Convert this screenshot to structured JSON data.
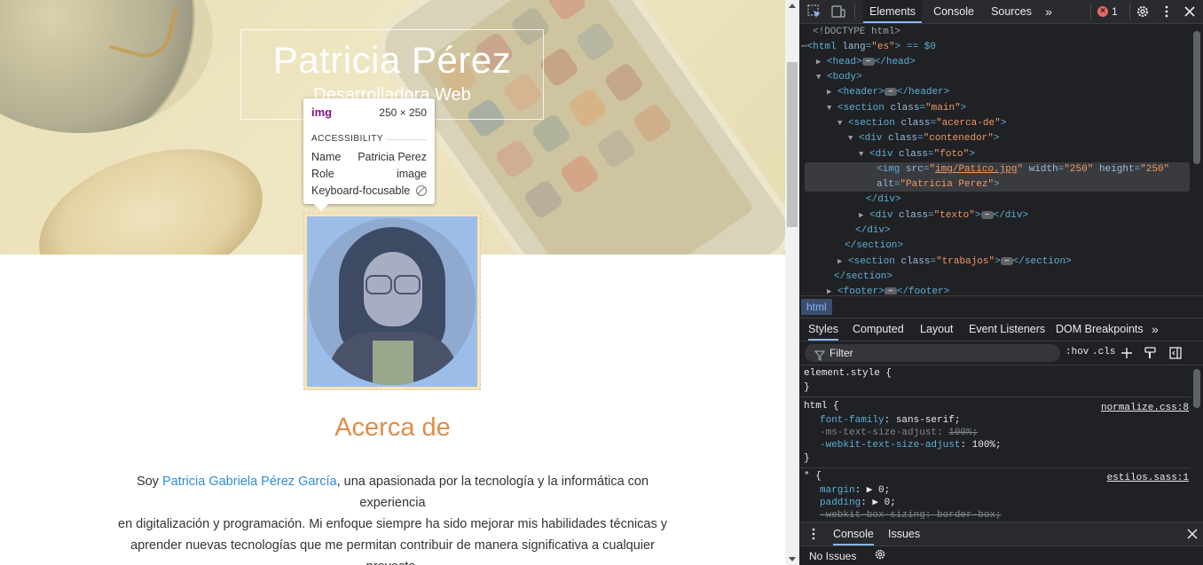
{
  "page": {
    "hero_name": "Patricia Pérez",
    "hero_role": "Desarrolladora Web",
    "about_title": "Acerca de",
    "about_prefix": "Soy ",
    "about_link": "Patricia Gabriela Pérez García",
    "about_line1_rest": ", una apasionada por la tecnología y la informática con experiencia",
    "about_line2": "en digitalización y programación. Mi enfoque siempre ha sido mejorar mis habilidades técnicas y",
    "about_line3": "aprender nuevas tecnologías que me permitan contribuir de manera significativa a cualquier proyecto.",
    "photo_alt": "Patricia Perez"
  },
  "tooltip": {
    "tag": "img",
    "size": "250 × 250",
    "section": "ACCESSIBILITY",
    "rows": [
      {
        "label": "Name",
        "value": "Patricia Perez"
      },
      {
        "label": "Role",
        "value": "image"
      },
      {
        "label": "Keyboard-focusable",
        "value": ""
      }
    ]
  },
  "devtools": {
    "tabs": [
      "Elements",
      "Console",
      "Sources"
    ],
    "active_tab": "Elements",
    "error_count": "1",
    "error_badge": "×",
    "icons": {
      "inspect": "inspect-icon",
      "device": "device-toggle-icon",
      "more_tabs": "chevrons-right-icon",
      "settings": "gear-icon",
      "menu": "kebab-menu-icon",
      "close": "close-icon"
    },
    "dom": {
      "doctype": "<!DOCTYPE html>",
      "html_open": "<html ",
      "html_lang_attr": "lang",
      "html_lang_val": "\"es\"",
      "html_suffix": "> == $0",
      "head": "<head>",
      "head_close": "</head>",
      "body": "<body>",
      "header": "<header>",
      "header_close": "</header>",
      "section_main_tag": "<section ",
      "section_main_attr": "class",
      "section_main_val": "\"main\"",
      "section_acerca_val": "\"acerca-de\"",
      "div_contenedor_val": "\"contenedor\"",
      "div_foto_val": "\"foto\"",
      "img_src_attr": "src",
      "img_src_val": "img/Patico.jpg",
      "img_width_attr": "width",
      "img_width_val": "\"250\"",
      "img_height_attr": "height",
      "img_height_val": "\"250\"",
      "img_alt_attr": "alt",
      "img_alt_val": "\"Patricia Perez\"",
      "div_close": "</div>",
      "div_texto_val": "\"texto\"",
      "section_close": "</section>",
      "section_trabajos_val": "\"trabajos\"",
      "footer": "<footer>",
      "footer_close": "</footer>"
    },
    "breadcrumb": "html",
    "subtabs": [
      "Styles",
      "Computed",
      "Layout",
      "Event Listeners",
      "DOM Breakpoints"
    ],
    "active_subtab": "Styles",
    "filter_placeholder": "Filter",
    "hov": ":hov",
    "cls": ".cls",
    "styles": {
      "element_style": "element.style {",
      "brace_close": "}",
      "html_selector": "html {",
      "html_source": "normalize.css:8",
      "font_family_prop": "font-family",
      "font_family_val": "sans-serif;",
      "ms_prop": "-ms-text-size-adjust",
      "ms_val": "100%;",
      "webkit_prop": "-webkit-text-size-adjust",
      "webkit_val": "100%;",
      "star_selector": "* {",
      "star_source": "estilos.sass:1",
      "margin_prop": "margin",
      "margin_val": "0;",
      "padding_prop": "padding",
      "padding_val": "0;",
      "box_prop": "-webkit-box-sizing",
      "box_val": "border-box;"
    },
    "drawer_tabs": [
      "Console",
      "Issues"
    ],
    "no_issues": "No Issues"
  },
  "colors": {
    "accent_orange": "#e08d49",
    "link_blue": "#2f8cd8",
    "devtools_bg": "#202124",
    "tab_active": "#8ab4f8"
  }
}
